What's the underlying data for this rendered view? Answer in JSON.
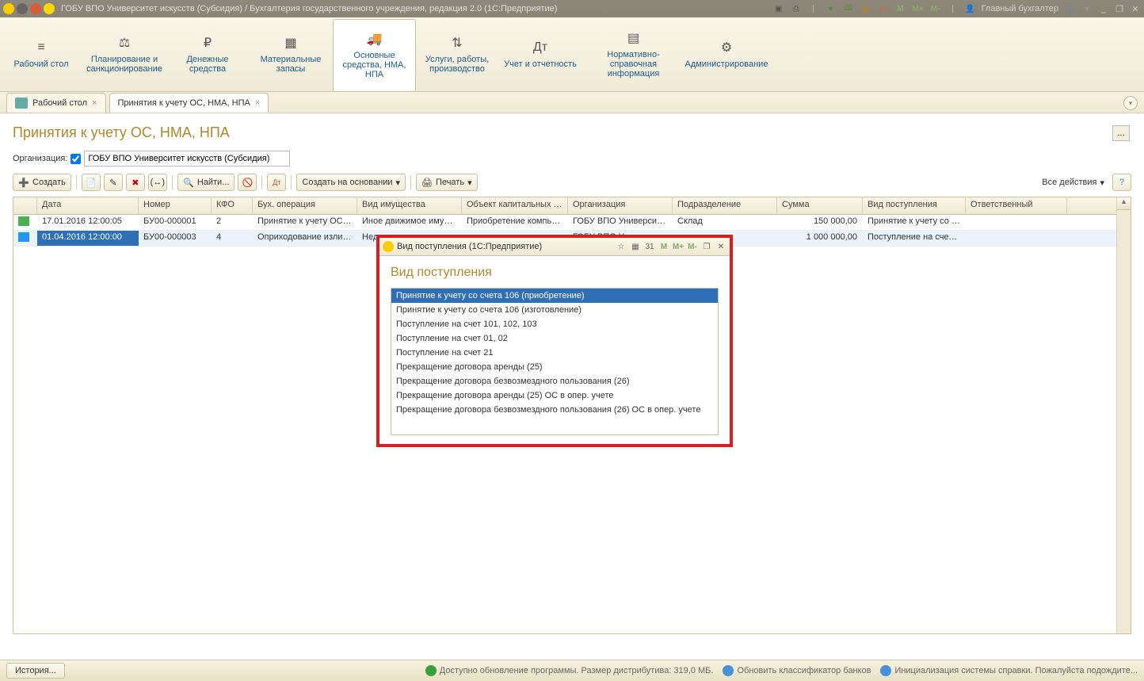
{
  "titlebar": {
    "title": "ГОБУ ВПО Университет искусств (Субсидия) / Бухгалтерия государственного учреждения, редакция 2.0  (1С:Предприятие)",
    "m": "M",
    "mplus": "M+",
    "mminus": "M-",
    "user": "Главный бухгалтер"
  },
  "sections": [
    {
      "label": "Рабочий стол"
    },
    {
      "label": "Планирование и санкционирование"
    },
    {
      "label": "Денежные средства"
    },
    {
      "label": "Материальные запасы"
    },
    {
      "label": "Основные средства, НМА, НПА"
    },
    {
      "label": "Услуги, работы, производство"
    },
    {
      "label": "Учет и отчетность"
    },
    {
      "label": "Нормативно-справочная информация"
    },
    {
      "label": "Администрирование"
    }
  ],
  "tabs": [
    {
      "label": "Рабочий стол"
    },
    {
      "label": "Принятия к учету ОС, НМА, НПА"
    }
  ],
  "page": {
    "title": "Принятия к учету ОС, НМА, НПА",
    "org_label": "Организация:",
    "org_value": "ГОБУ ВПО Университет искусств (Субсидия)"
  },
  "toolbar": {
    "create": "Создать",
    "find": "Найти...",
    "create_based": "Создать на основании",
    "print": "Печать",
    "all_actions": "Все действия"
  },
  "grid": {
    "headers": {
      "date": "Дата",
      "num": "Номер",
      "kfo": "КФО",
      "op": "Бух. операция",
      "prop": "Вид имущества",
      "cap": "Объект капитальных в...",
      "org": "Организация",
      "dept": "Подразделение",
      "sum": "Сумма",
      "type": "Вид поступления",
      "resp": "Ответственный"
    },
    "rows": [
      {
        "date": "17.01.2016 12:00:05",
        "num": "БУ00-000001",
        "kfo": "2",
        "op": "Принятие к учету ОС, Н...",
        "prop": "Иное движимое имуще...",
        "cap": "Приобретение компью...",
        "org": "ГОБУ ВПО Университе...",
        "dept": "Склад",
        "sum": "150 000,00",
        "type": "Принятие к учету со сч...",
        "resp": ""
      },
      {
        "date": "01.04.2016 12:00:00",
        "num": "БУ00-000003",
        "kfo": "4",
        "op": "Оприходование излиш...",
        "prop": "Недвижимое имущество",
        "cap": "",
        "org": "ГОБУ ВПО Университе...",
        "dept": "",
        "sum": "1 000 000,00",
        "type": "Поступление на счет 1...",
        "resp": ""
      }
    ]
  },
  "popup": {
    "window_title": "Вид поступления  (1С:Предприятие)",
    "heading": "Вид поступления",
    "m": "M",
    "mplus": "M+",
    "mminus": "M-",
    "items": [
      "Принятие к учету со счета 106 (приобретение)",
      "Принятие к учету со счета 106 (изготовление)",
      "Поступление на счет 101, 102, 103",
      "Поступление на счет 01, 02",
      "Поступление на счет 21",
      "Прекращение договора аренды (25)",
      "Прекращение договора безвозмездного пользования (26)",
      "Прекращение договора аренды (25) ОС в опер. учете",
      "Прекращение договора безвозмездного пользования (26) ОС в опер. учете"
    ]
  },
  "statusbar": {
    "history": "История...",
    "update": "Доступно обновление программы. Размер дистрибутива: 319,0 МБ.",
    "banks": "Обновить классификатор банков",
    "help": "Инициализация системы справки. Пожалуйста подождите..."
  }
}
